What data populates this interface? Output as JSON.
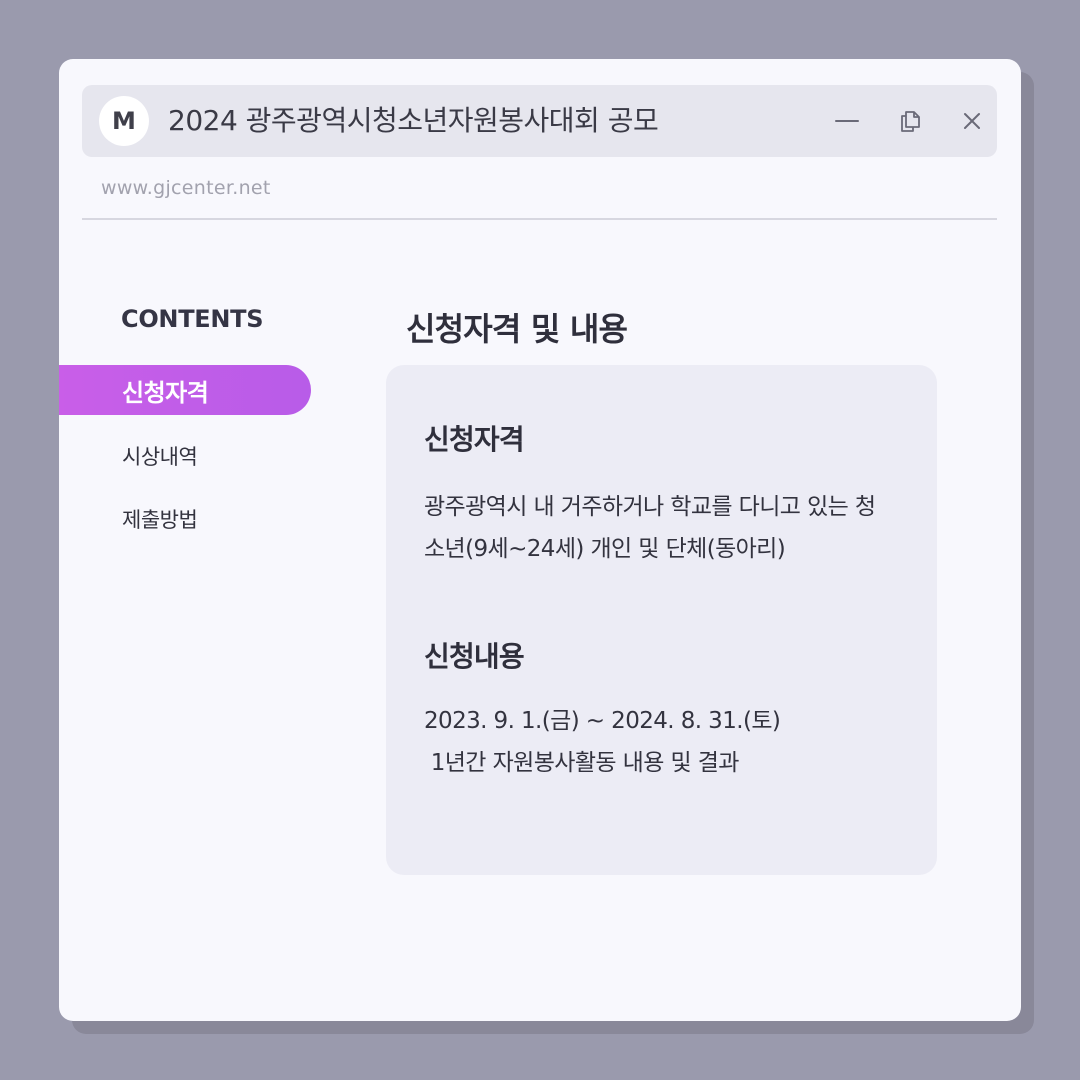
{
  "window": {
    "avatar_letter": "M",
    "title": "2024 광주광역시청소년자원봉사대회 공모",
    "url": "www.gjcenter.net",
    "controls": {
      "minimize_icon": "minimize-icon",
      "copy_icon": "copy-icon",
      "close_icon": "close-icon"
    }
  },
  "sidebar": {
    "heading": "CONTENTS",
    "items": [
      {
        "label": "신청자격",
        "active": true
      },
      {
        "label": "시상내역",
        "active": false
      },
      {
        "label": "제출방법",
        "active": false
      }
    ],
    "accent_color": "#c45ce8"
  },
  "main": {
    "title": "신청자격 및 내용",
    "card": {
      "section1": {
        "heading": "신청자격",
        "text": "광주광역시 내 거주하거나 학교를 다니고 있는 청소년(9세~24세) 개인 및 단체(동아리)"
      },
      "section2": {
        "heading": "신청내용",
        "line1": "2023. 9. 1.(금) ~ 2024. 8. 31.(토)",
        "line2": " 1년간 자원봉사활동 내용 및 결과"
      }
    }
  }
}
